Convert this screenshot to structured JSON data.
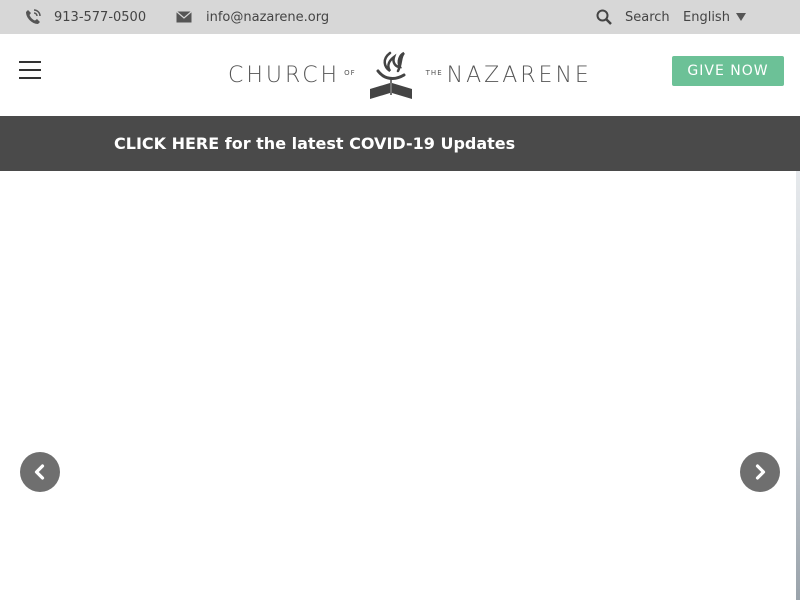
{
  "topbar": {
    "phone": "913-577-0500",
    "email": "info@nazarene.org",
    "search_label": "Search",
    "language": "English"
  },
  "header": {
    "menu_icon": "hamburger-menu-icon",
    "logo": {
      "word_left": "CHURCH",
      "small_of": "OF",
      "small_the": "THE",
      "word_right": "NAZARENE"
    },
    "give_label": "GIVE NOW",
    "give_color": "#6cc197"
  },
  "banner": {
    "text": "CLICK HERE for the latest COVID-19 Updates",
    "background": "#4a4a4a"
  },
  "carousel": {
    "prev_icon": "chevron-left-icon",
    "next_icon": "chevron-right-icon"
  }
}
